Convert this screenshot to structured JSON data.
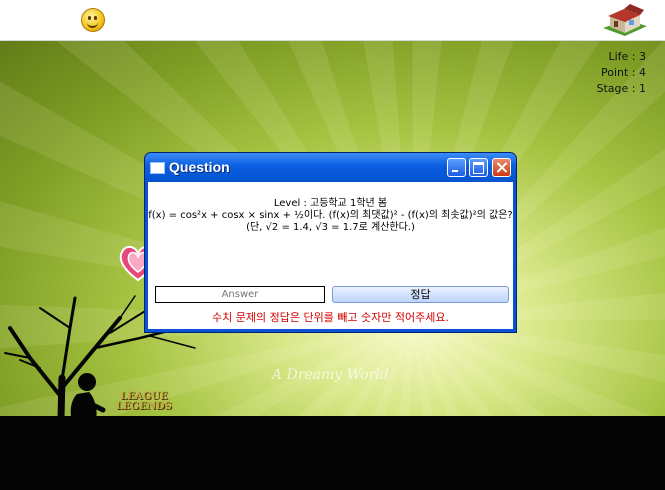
{
  "hud": {
    "life": "Life : 3",
    "point": "Point : 4",
    "stage": "Stage : 1"
  },
  "icons": {
    "smiley": "smiley-face-icon",
    "home": "house-icon"
  },
  "scene": {
    "watermark": "A Dreamy World",
    "logo_line1": "LEAGUE",
    "logo_line2": "LEGENDS"
  },
  "dialog": {
    "title": "Question",
    "level": "Level : 고등학교 1학년 봄",
    "question_line1": "f(x) = cos²x + cosx × sinx + ½이다. (f(x)의 최댓값)² - (f(x)의 최솟값)²의 값은?",
    "question_line2": "(단, √2 = 1.4, √3 = 1.7로 계산한다.)",
    "answer_placeholder": "Answer",
    "submit_label": "정답",
    "note": "수치 문제의 정답은 단위를 빼고 숫자만 적어주세요."
  },
  "colors": {
    "titlebar": "#0a5ee0",
    "note_text": "#d40000",
    "scene_green": "#a7c443",
    "ground": "#050505"
  }
}
